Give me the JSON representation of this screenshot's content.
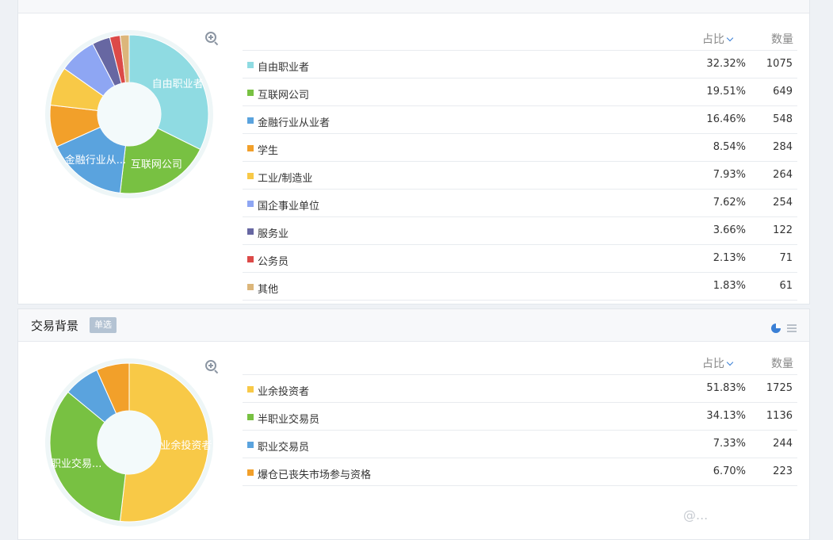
{
  "section1": {
    "columns": {
      "pct": "占比",
      "count": "数量"
    },
    "chart_data": {
      "type": "pie",
      "categories": [
        "自由职业者",
        "互联网公司",
        "金融行业从业者",
        "学生",
        "工业/制造业",
        "国企事业单位",
        "服务业",
        "公务员",
        "其他"
      ],
      "values": [
        32.32,
        19.51,
        16.46,
        8.54,
        7.93,
        7.62,
        3.66,
        2.13,
        1.83
      ],
      "counts": [
        1075,
        649,
        548,
        284,
        264,
        254,
        122,
        71,
        61
      ],
      "pct_labels": [
        "32.32%",
        "19.51%",
        "16.46%",
        "8.54%",
        "7.93%",
        "7.62%",
        "3.66%",
        "2.13%",
        "1.83%"
      ],
      "colors": [
        "#8fdbe2",
        "#78c142",
        "#5aa3de",
        "#f2a02a",
        "#f8c947",
        "#8ea6f3",
        "#6767a2",
        "#dc4a48",
        "#dcb67a"
      ],
      "slice_labels": [
        "自由职业者",
        "互联网公司",
        "金融行业从..."
      ]
    }
  },
  "section2": {
    "title": "交易背景",
    "tag": "单选",
    "columns": {
      "pct": "占比",
      "count": "数量"
    },
    "chart_data": {
      "type": "pie",
      "categories": [
        "业余投资者",
        "半职业交易员",
        "职业交易员",
        "爆仓已丧失市场参与资格"
      ],
      "values": [
        51.83,
        34.13,
        7.33,
        6.7
      ],
      "counts": [
        1725,
        1136,
        244,
        223
      ],
      "pct_labels": [
        "51.83%",
        "34.13%",
        "7.33%",
        "6.70%"
      ],
      "colors": [
        "#f8c947",
        "#78c142",
        "#5aa3de",
        "#f2a02a"
      ],
      "slice_labels": [
        "业余投资者",
        "职业交易..."
      ]
    }
  },
  "watermark": "@..."
}
